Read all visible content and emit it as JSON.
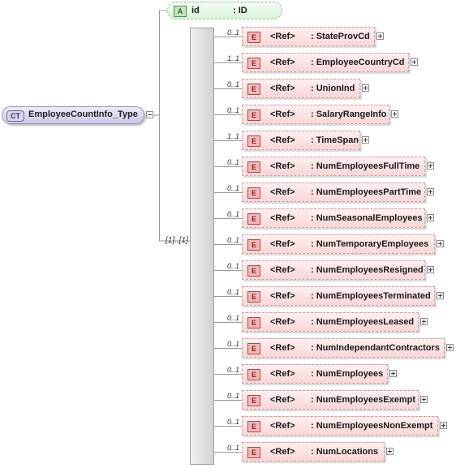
{
  "complex_type": {
    "badge": "CT",
    "name": "EmployeeCountInfo_Type"
  },
  "attribute": {
    "badge": "A",
    "name": "id",
    "type": ": ID"
  },
  "sequence": {
    "occurrence": "[1]..[1]"
  },
  "elements": [
    {
      "occ": "0..1",
      "badge": "E",
      "ref": "<Ref>",
      "name": ": StateProvCd"
    },
    {
      "occ": "1..1",
      "badge": "E",
      "ref": "<Ref>",
      "name": ": EmployeeCountryCd"
    },
    {
      "occ": "0..1",
      "badge": "E",
      "ref": "<Ref>",
      "name": ": UnionInd"
    },
    {
      "occ": "0..1",
      "badge": "E",
      "ref": "<Ref>",
      "name": ": SalaryRangeInfo"
    },
    {
      "occ": "1..1",
      "badge": "E",
      "ref": "<Ref>",
      "name": ": TimeSpan"
    },
    {
      "occ": "0..1",
      "badge": "E",
      "ref": "<Ref>",
      "name": ": NumEmployeesFullTime"
    },
    {
      "occ": "0..1",
      "badge": "E",
      "ref": "<Ref>",
      "name": ": NumEmployeesPartTime"
    },
    {
      "occ": "0..1",
      "badge": "E",
      "ref": "<Ref>",
      "name": ": NumSeasonalEmployees"
    },
    {
      "occ": "0..1",
      "badge": "E",
      "ref": "<Ref>",
      "name": ": NumTemporaryEmployees"
    },
    {
      "occ": "0..1",
      "badge": "E",
      "ref": "<Ref>",
      "name": ": NumEmployeesResigned"
    },
    {
      "occ": "0..1",
      "badge": "E",
      "ref": "<Ref>",
      "name": ": NumEmployeesTerminated"
    },
    {
      "occ": "0..1",
      "badge": "E",
      "ref": "<Ref>",
      "name": ": NumEmployeesLeased"
    },
    {
      "occ": "0..1",
      "badge": "E",
      "ref": "<Ref>",
      "name": ": NumIndependantContractors"
    },
    {
      "occ": "0..1",
      "badge": "E",
      "ref": "<Ref>",
      "name": ": NumEmployees"
    },
    {
      "occ": "0..1",
      "badge": "E",
      "ref": "<Ref>",
      "name": ": NumEmployeesExempt"
    },
    {
      "occ": "0..1",
      "badge": "E",
      "ref": "<Ref>",
      "name": ": NumEmployeesNonExempt"
    },
    {
      "occ": "0..1",
      "badge": "E",
      "ref": "<Ref>",
      "name": ": NumLocations"
    }
  ]
}
